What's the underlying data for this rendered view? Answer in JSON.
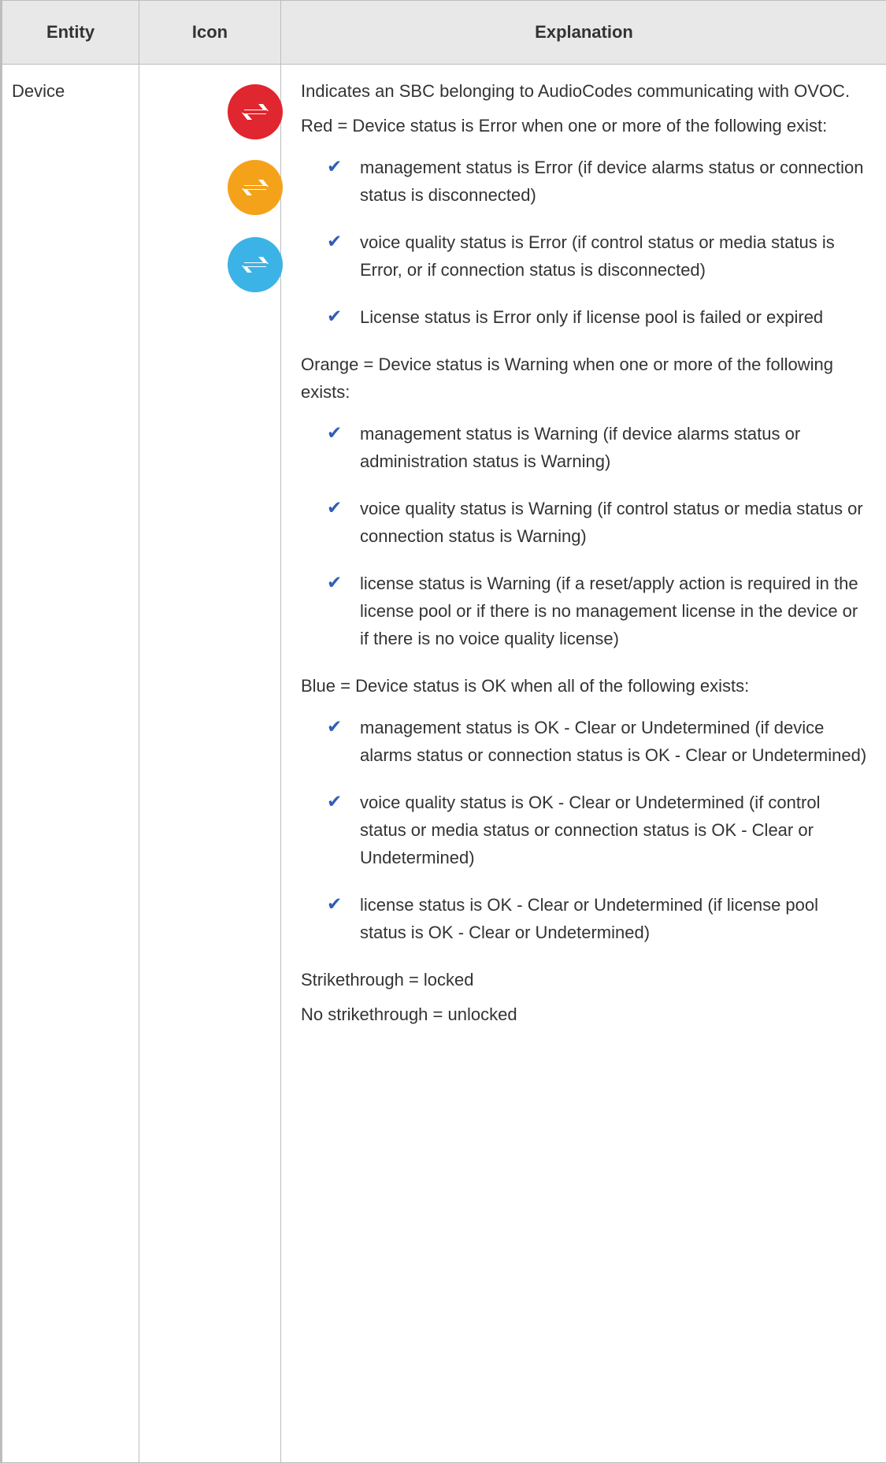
{
  "table": {
    "headers": {
      "entity": "Entity",
      "icon": "Icon",
      "explanation": "Explanation"
    },
    "row": {
      "entity": "Device",
      "icons": [
        {
          "name": "device-error-icon",
          "color": "#e0262e"
        },
        {
          "name": "device-warning-icon",
          "color": "#f5a21b"
        },
        {
          "name": "device-ok-icon",
          "color": "#3bb3e6"
        }
      ],
      "intro": "Indicates an SBC belonging to AudioCodes communicating with OVOC.",
      "red": {
        "heading": "Red = Device status is Error when one or more of the following exist:",
        "items": [
          "management status is Error (if device alarms status or connection status is disconnected)",
          "voice quality status is Error (if control status or media status is Error, or if connection status is disconnected)",
          "License status is Error only if license pool is failed or expired"
        ]
      },
      "orange": {
        "heading": "Orange = Device status is Warning when one or more of the following exists:",
        "items": [
          "management status is Warning (if device alarms status or administration status is Warning)",
          "voice quality status is Warning (if control status or media status or connection status is Warning)",
          "license status is Warning (if a reset/apply action is required in the license pool or if there is no management license in the device or if there is no voice quality license)"
        ]
      },
      "blue": {
        "heading": "Blue = Device status is OK when all of the following exists:",
        "items": [
          "management status is OK - Clear or Undetermined (if device alarms status or connection status is OK - Clear or Undetermined)",
          "voice quality status is OK - Clear or Undetermined (if control status or media status or connection status is OK - Clear or Undetermined)",
          "license status is OK - Clear or Undetermined (if license pool status is OK - Clear or Undetermined)"
        ]
      },
      "strikethrough": "Strikethrough = locked",
      "no_strikethrough": "No strikethrough = unlocked"
    },
    "check_glyph": "✔",
    "accent_color": "#2f5eb5",
    "header_bg": "#e8e8e8"
  }
}
